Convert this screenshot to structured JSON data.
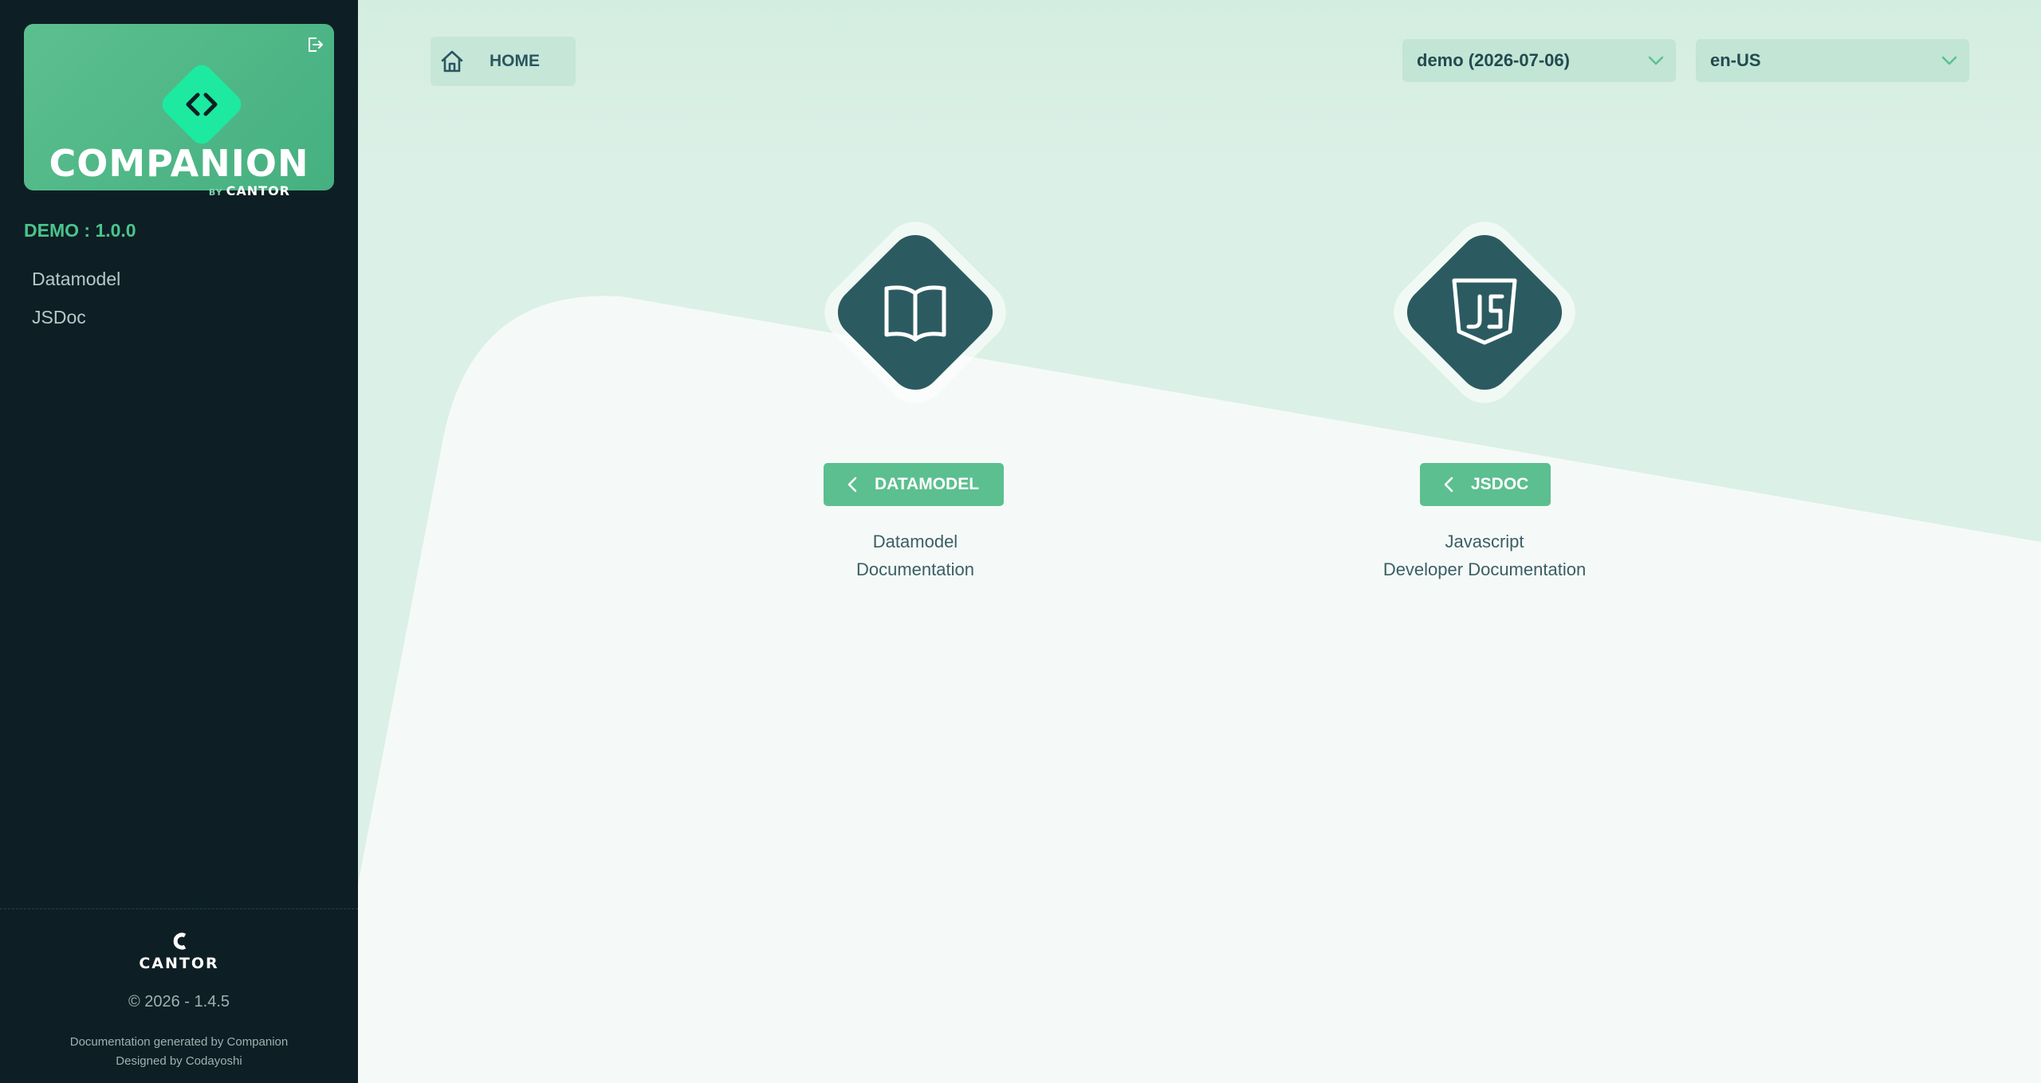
{
  "sidebar": {
    "logo_text": "COMPANION",
    "logo_by": "BY",
    "logo_sub": "CANTOR",
    "version_label": "DEMO : 1.0.0",
    "nav": [
      {
        "label": "Datamodel",
        "icon": "none"
      },
      {
        "label": "JSDoc",
        "icon": "none"
      }
    ],
    "footer": {
      "brand": "CANTOR",
      "copyright": "© 2026 - 1.4.5",
      "generated_by": "Documentation generated by Companion",
      "designed_by": "Designed by Codayoshi"
    }
  },
  "header": {
    "home_label": "HOME",
    "version_select": "demo (2026-07-06)",
    "language_select": "en-US"
  },
  "cards": [
    {
      "button_label": "DATAMODEL",
      "desc_line1": "Datamodel",
      "desc_line2": "Documentation",
      "icon": "book-icon"
    },
    {
      "button_label": "JSDOC",
      "desc_line1": "Javascript",
      "desc_line2": "Developer Documentation",
      "icon": "js-shield-icon"
    }
  ],
  "colors": {
    "sidebar_bg": "#0d1f24",
    "accent": "#5cbf8f",
    "accent_text": "#4cc48c",
    "diamond": "#2b5b61",
    "logo_diamond": "#1de9a1"
  }
}
